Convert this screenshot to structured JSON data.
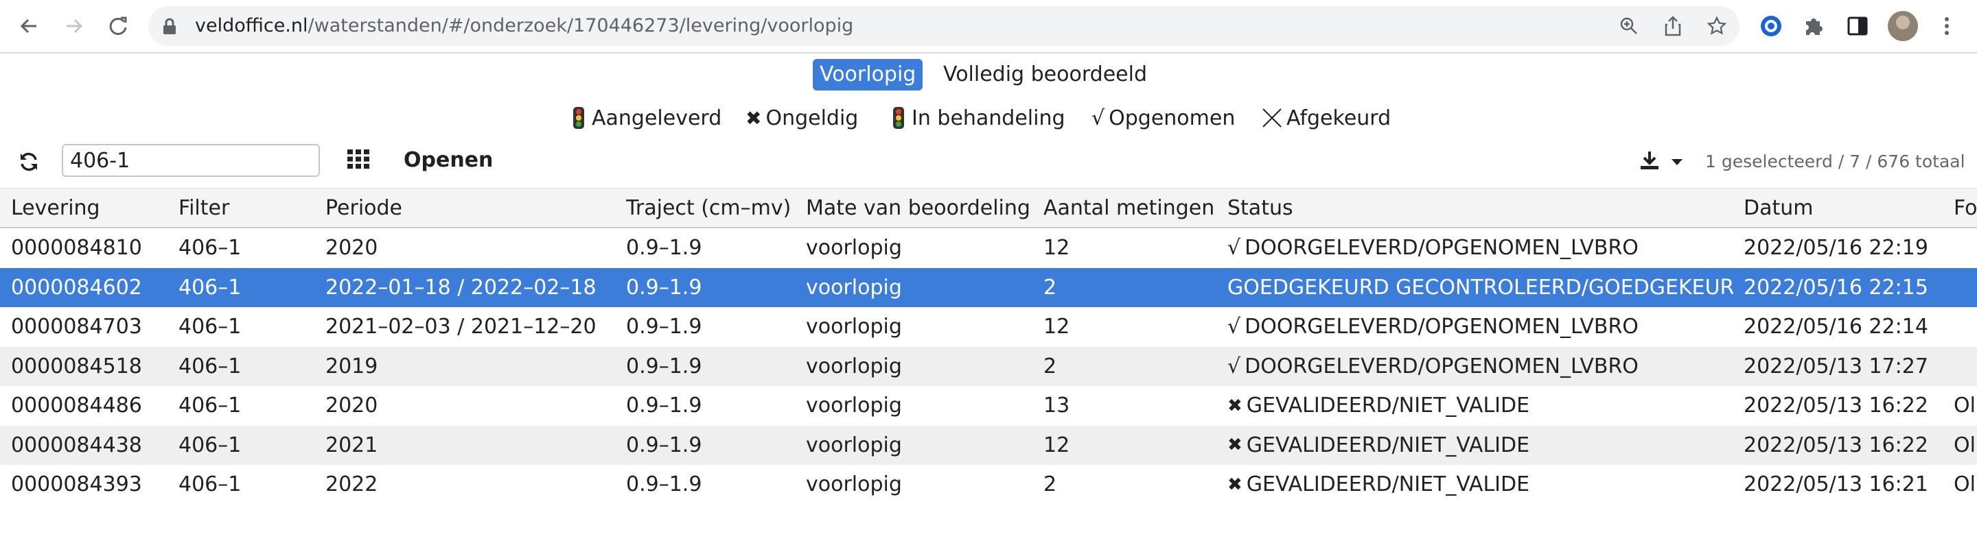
{
  "browser": {
    "url_host": "veldoffice.nl",
    "url_path": "/waterstanden/#/onderzoek/170446273/levering/voorlopig"
  },
  "mode_tabs": [
    {
      "label": "Voorlopig",
      "active": true
    },
    {
      "label": "Volledig beoordeeld",
      "active": false
    }
  ],
  "legend": [
    {
      "icon": "traffic-light-icon",
      "label": "Aangeleverd"
    },
    {
      "icon": "cross-icon",
      "label": "Ongeldig"
    },
    {
      "icon": "traffic-light-icon",
      "label": "In behandeling"
    },
    {
      "icon": "check-icon",
      "label": "Opgenomen"
    },
    {
      "icon": "thin-cross-icon",
      "label": "Afgekeurd"
    }
  ],
  "toolbar": {
    "filter_value": "406-1",
    "open_label": "Openen",
    "count_text": "1 geselecteerd / 7 / 676 totaal"
  },
  "table": {
    "columns": [
      "Levering",
      "Filter",
      "Periode",
      "Traject (cm–mv)",
      "Mate van beoordeling",
      "Aantal metingen",
      "Status",
      "Datum",
      "Fo"
    ],
    "rows": [
      {
        "levering": "0000084810",
        "filter": "406–1",
        "periode": "2020",
        "traject": "0.9–1.9",
        "mate": "voorlopig",
        "aantal": "12",
        "status_icon": "√",
        "status": "DOORGELEVERD/OPGENOMEN_LVBRO",
        "datum": "2022/05/16 22:19",
        "extra": "",
        "selected": false
      },
      {
        "levering": "0000084602",
        "filter": "406–1",
        "periode": "2022–01–18 / 2022–02–18",
        "traject": "0.9–1.9",
        "mate": "voorlopig",
        "aantal": "2",
        "status_icon": "",
        "status": "GOEDGEKEURD GECONTROLEERD/GOEDGEKEURD",
        "datum": "2022/05/16 22:15",
        "extra": "",
        "selected": true
      },
      {
        "levering": "0000084703",
        "filter": "406–1",
        "periode": "2021–02–03 / 2021–12–20",
        "traject": "0.9–1.9",
        "mate": "voorlopig",
        "aantal": "12",
        "status_icon": "√",
        "status": "DOORGELEVERD/OPGENOMEN_LVBRO",
        "datum": "2022/05/16 22:14",
        "extra": "",
        "selected": false
      },
      {
        "levering": "0000084518",
        "filter": "406–1",
        "periode": "2019",
        "traject": "0.9–1.9",
        "mate": "voorlopig",
        "aantal": "2",
        "status_icon": "√",
        "status": "DOORGELEVERD/OPGENOMEN_LVBRO",
        "datum": "2022/05/13 17:27",
        "extra": "",
        "selected": false
      },
      {
        "levering": "0000084486",
        "filter": "406–1",
        "periode": "2020",
        "traject": "0.9–1.9",
        "mate": "voorlopig",
        "aantal": "13",
        "status_icon": "✖",
        "status": "GEVALIDEERD/NIET_VALIDE",
        "datum": "2022/05/13 16:22",
        "extra": "Ol",
        "selected": false
      },
      {
        "levering": "0000084438",
        "filter": "406–1",
        "periode": "2021",
        "traject": "0.9–1.9",
        "mate": "voorlopig",
        "aantal": "12",
        "status_icon": "✖",
        "status": "GEVALIDEERD/NIET_VALIDE",
        "datum": "2022/05/13 16:22",
        "extra": "Ol",
        "selected": false
      },
      {
        "levering": "0000084393",
        "filter": "406–1",
        "periode": "2022",
        "traject": "0.9–1.9",
        "mate": "voorlopig",
        "aantal": "2",
        "status_icon": "✖",
        "status": "GEVALIDEERD/NIET_VALIDE",
        "datum": "2022/05/13 16:21",
        "extra": "Ol",
        "selected": false
      }
    ]
  },
  "colors": {
    "accent": "#3b7dd8",
    "row_alt": "#efefef",
    "header_bg": "#f4f4f4"
  }
}
